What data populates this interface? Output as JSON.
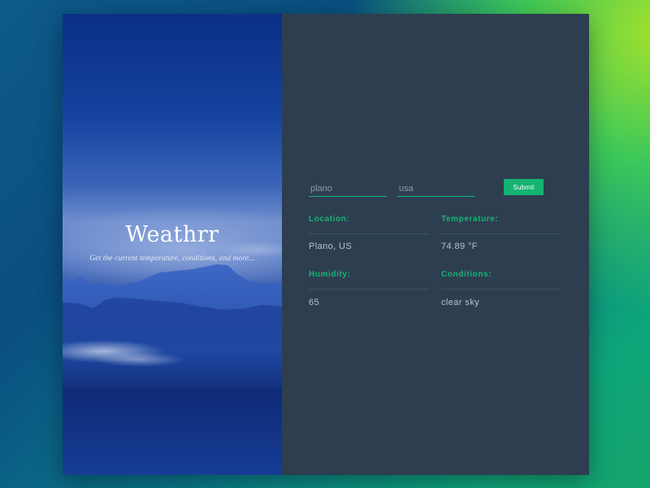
{
  "hero": {
    "title": "Weathrr",
    "subtitle": "Get the current temperature, conditions, and more..."
  },
  "form": {
    "city_placeholder": "plano",
    "country_placeholder": "usa",
    "submit_label": "Submit"
  },
  "results": {
    "location_label": "Location:",
    "location_value": "Plano, US",
    "temperature_label": "Temperature:",
    "temperature_value": "74.89 °F",
    "humidity_label": "Humidity:",
    "humidity_value": "65",
    "conditions_label": "Conditions:",
    "conditions_value": "clear sky"
  },
  "colors": {
    "accent": "#15b371",
    "panel_bg": "#2d3e50",
    "label_color": "#17b374",
    "value_color": "#b7c2cf"
  }
}
